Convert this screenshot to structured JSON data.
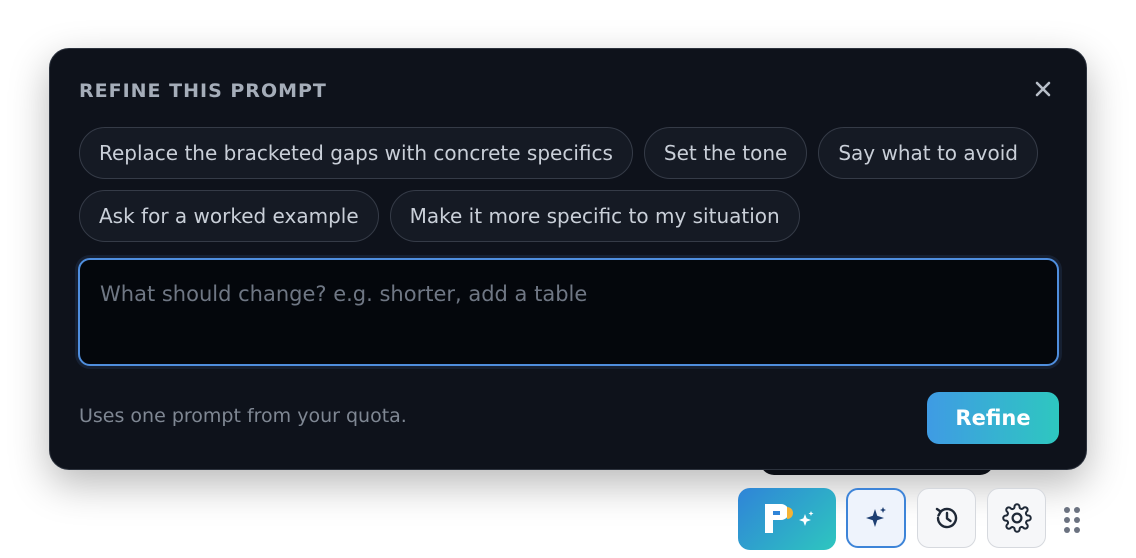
{
  "panel": {
    "title": "REFINE THIS PROMPT",
    "close_icon": "close-icon",
    "chips_row1": [
      "Replace the bracketed gaps with concrete specifics",
      "Set the tone",
      "Say what to avoid"
    ],
    "chips_row2": [
      "Ask for a worked example",
      "Make it more specific to my situation"
    ],
    "input": {
      "placeholder": "What should change? e.g. shorter, add a table",
      "value": ""
    },
    "quota_note": "Uses one prompt from your quota.",
    "refine_label": "Refine"
  },
  "toolbar": {
    "logo_icon": "app-logo-icon",
    "items": [
      "sparkle-icon",
      "history-icon",
      "gear-icon",
      "drag-handle-icon"
    ]
  },
  "colors": {
    "panel_bg": "#0e121b",
    "accent_blue": "#4f8ede",
    "gradient_start": "#3f9be4",
    "gradient_end": "#2ec7c0"
  }
}
